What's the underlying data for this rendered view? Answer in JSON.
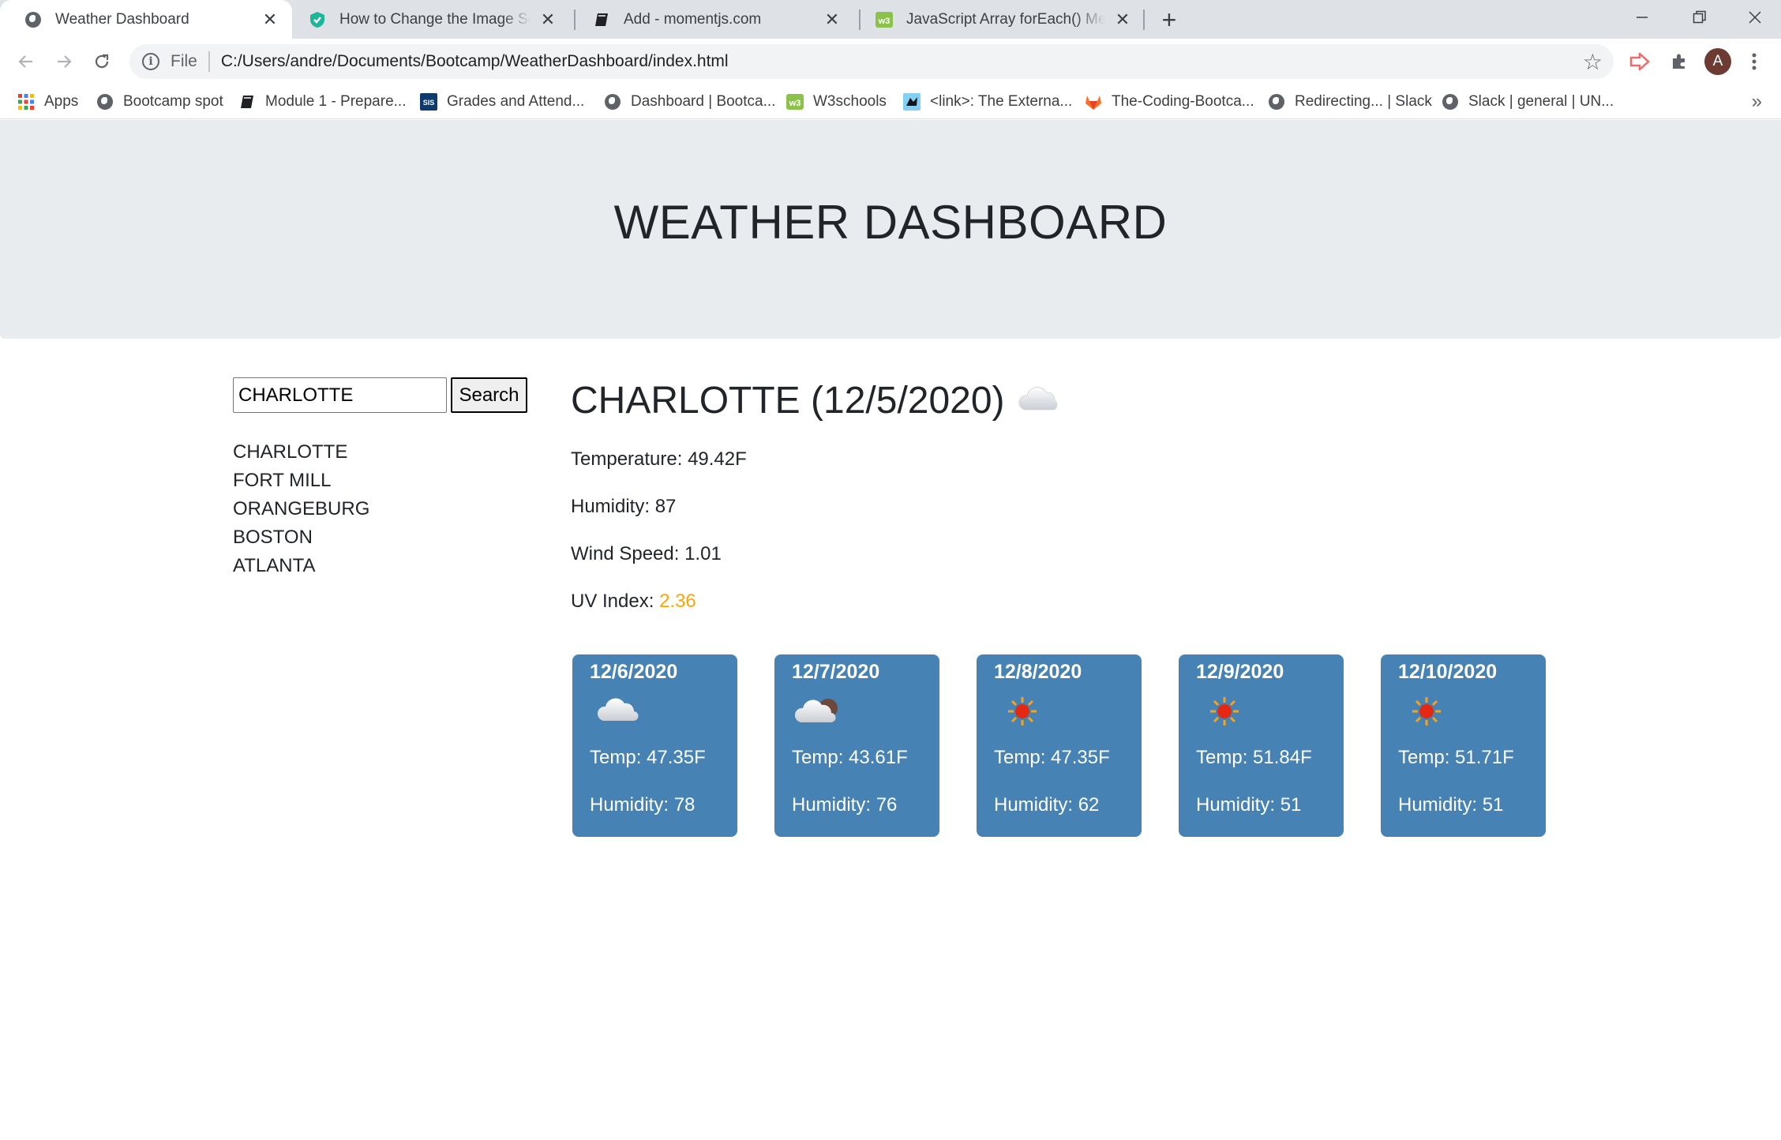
{
  "browser": {
    "tabs": [
      {
        "title": "Weather Dashboard",
        "icon": "globe-icon",
        "active": true
      },
      {
        "title": "How to Change the Image Source",
        "icon": "shield-favicon-icon",
        "active": false
      },
      {
        "title": "Add - momentjs.com",
        "icon": "book-icon",
        "active": false
      },
      {
        "title": "JavaScript Array forEach() Method",
        "icon": "w3schools-icon",
        "active": false
      }
    ],
    "new_tab": "+",
    "address": {
      "scheme_label": "File",
      "url": "C:/Users/andre/Documents/Bootcamp/WeatherDashboard/index.html"
    },
    "avatar_initial": "A",
    "bookmarks": [
      {
        "label": "Apps",
        "icon": "apps-grid-icon"
      },
      {
        "label": "Bootcamp spot",
        "icon": "globe-icon"
      },
      {
        "label": "Module 1 - Prepare...",
        "icon": "book-icon"
      },
      {
        "label": "Grades and Attend...",
        "icon": "sis-icon"
      },
      {
        "label": "Dashboard | Bootca...",
        "icon": "globe-icon"
      },
      {
        "label": "W3schools",
        "icon": "w3schools-icon"
      },
      {
        "label": "<link>: The Externa...",
        "icon": "mdn-icon"
      },
      {
        "label": "The-Coding-Bootca...",
        "icon": "gitlab-icon"
      },
      {
        "label": "Redirecting... | Slack",
        "icon": "globe-icon"
      },
      {
        "label": "Slack | general | UN...",
        "icon": "globe-icon"
      }
    ],
    "bookmarks_more": "»"
  },
  "page": {
    "header_title": "WEATHER DASHBOARD",
    "search": {
      "value": "CHARLOTTE",
      "button_label": "Search"
    },
    "history": [
      "CHARLOTTE",
      "FORT MILL",
      "ORANGEBURG",
      "BOSTON",
      "ATLANTA"
    ],
    "current": {
      "title": "CHARLOTTE (12/5/2020)",
      "icon": "cloud-icon",
      "temperature": "Temperature: 49.42F",
      "humidity": "Humidity: 87",
      "wind": "Wind Speed: 1.01",
      "uv_label": "UV Index: ",
      "uv_value": "2.36",
      "uv_color": "#ffa500"
    },
    "forecast": [
      {
        "date": "12/6/2020",
        "icon": "cloud-icon",
        "temp": "Temp: 47.35F",
        "humidity": "Humidity: 78"
      },
      {
        "date": "12/7/2020",
        "icon": "cloud-partial-icon",
        "temp": "Temp: 43.61F",
        "humidity": "Humidity: 76"
      },
      {
        "date": "12/8/2020",
        "icon": "sun-icon",
        "temp": "Temp: 47.35F",
        "humidity": "Humidity: 62"
      },
      {
        "date": "12/9/2020",
        "icon": "sun-icon",
        "temp": "Temp: 51.84F",
        "humidity": "Humidity: 51"
      },
      {
        "date": "12/10/2020",
        "icon": "sun-icon",
        "temp": "Temp: 51.71F",
        "humidity": "Humidity: 51"
      }
    ],
    "card_color": "#4682b4"
  }
}
